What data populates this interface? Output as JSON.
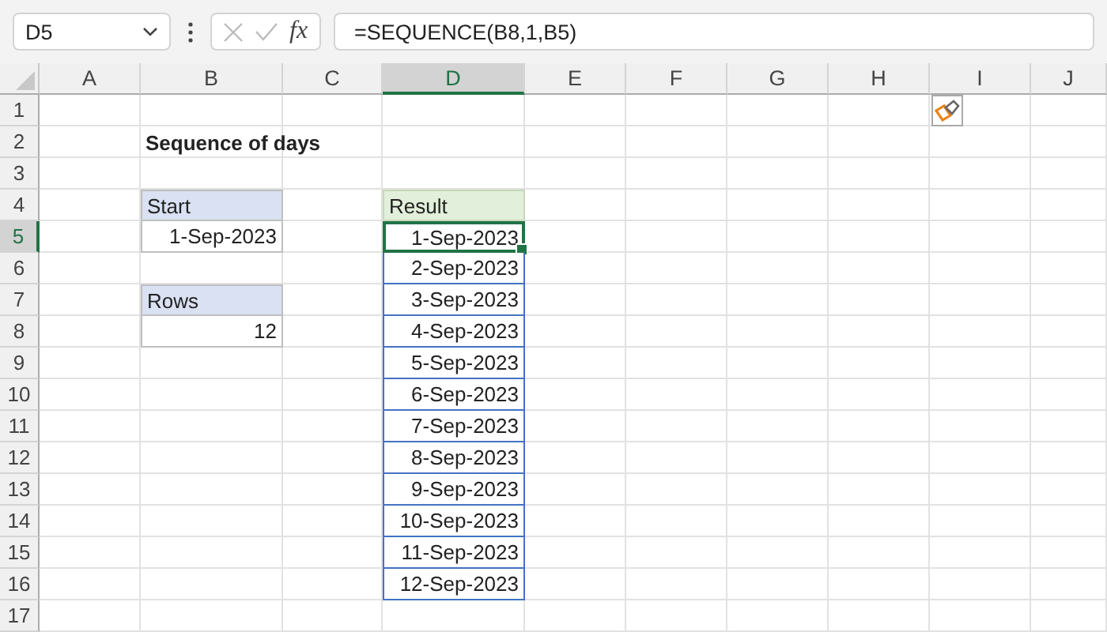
{
  "name_box": "D5",
  "function_label": "fx",
  "formula": "=SEQUENCE(B8,1,B5)",
  "columns": [
    {
      "label": "A",
      "selected": false
    },
    {
      "label": "B",
      "selected": false
    },
    {
      "label": "C",
      "selected": false
    },
    {
      "label": "D",
      "selected": true
    },
    {
      "label": "E",
      "selected": false
    },
    {
      "label": "F",
      "selected": false
    },
    {
      "label": "G",
      "selected": false
    },
    {
      "label": "H",
      "selected": false
    },
    {
      "label": "I",
      "selected": false
    },
    {
      "label": "J",
      "selected": false
    }
  ],
  "rows": [
    {
      "label": "1",
      "selected": false
    },
    {
      "label": "2",
      "selected": false
    },
    {
      "label": "3",
      "selected": false
    },
    {
      "label": "4",
      "selected": false
    },
    {
      "label": "5",
      "selected": true
    },
    {
      "label": "6",
      "selected": false
    },
    {
      "label": "7",
      "selected": false
    },
    {
      "label": "8",
      "selected": false
    },
    {
      "label": "9",
      "selected": false
    },
    {
      "label": "10",
      "selected": false
    },
    {
      "label": "11",
      "selected": false
    },
    {
      "label": "12",
      "selected": false
    },
    {
      "label": "13",
      "selected": false
    },
    {
      "label": "14",
      "selected": false
    },
    {
      "label": "15",
      "selected": false
    },
    {
      "label": "16",
      "selected": false
    },
    {
      "label": "17",
      "selected": false
    }
  ],
  "title": "Sequence of days",
  "inputs": [
    {
      "label": "Start",
      "value": "1-Sep-2023"
    },
    {
      "label": "Rows",
      "value": "12"
    }
  ],
  "result": {
    "header": "Result",
    "values": [
      {
        "text": "1-Sep-2023",
        "selected": true
      },
      {
        "text": "2-Sep-2023",
        "selected": false
      },
      {
        "text": "3-Sep-2023",
        "selected": false
      },
      {
        "text": "4-Sep-2023",
        "selected": false
      },
      {
        "text": "5-Sep-2023",
        "selected": false
      },
      {
        "text": "6-Sep-2023",
        "selected": false
      },
      {
        "text": "7-Sep-2023",
        "selected": false
      },
      {
        "text": "8-Sep-2023",
        "selected": false
      },
      {
        "text": "9-Sep-2023",
        "selected": false
      },
      {
        "text": "10-Sep-2023",
        "selected": false
      },
      {
        "text": "11-Sep-2023",
        "selected": false
      },
      {
        "text": "12-Sep-2023",
        "selected": false
      }
    ]
  }
}
